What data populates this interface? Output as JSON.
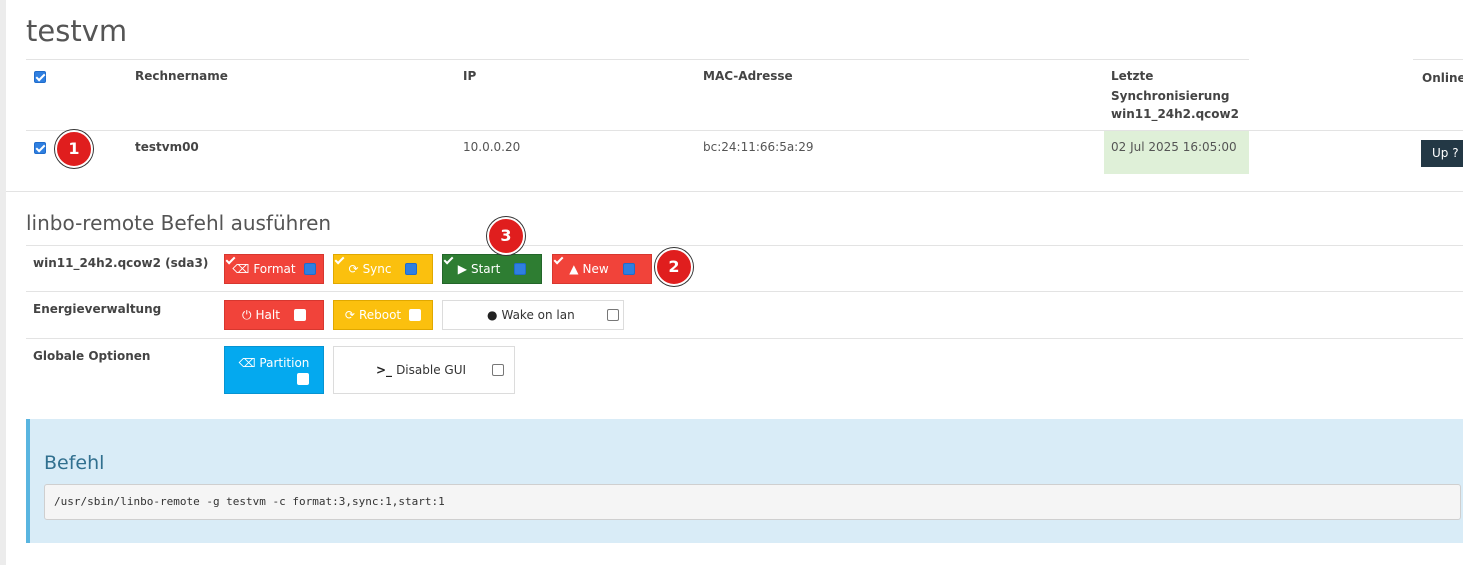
{
  "page": {
    "title": "testvm"
  },
  "table": {
    "headers": {
      "hostname": "Rechnername",
      "ip": "IP",
      "mac": "MAC-Adresse",
      "sync_line1": "Letzte",
      "sync_line2": "Synchronisierung",
      "sync_line3": "win11_24h2.qcow2",
      "online": "Online T"
    },
    "rows": [
      {
        "hostname": "testvm00",
        "ip": "10.0.0.20",
        "mac": "bc:24:11:66:5a:29",
        "last_sync": "02 Jul 2025 16:05:00",
        "online_button": "Up ?"
      }
    ]
  },
  "command_section": {
    "title": "linbo-remote Befehl ausführen",
    "rows": {
      "os_label": "win11_24h2.qcow2 (sda3)",
      "power_label": "Energieverwaltung",
      "global_label": "Globale Optionen"
    },
    "buttons": {
      "format": "Format",
      "sync": "Sync",
      "start": "Start",
      "new": "New",
      "halt": "Halt",
      "reboot": "Reboot",
      "wol": "Wake on lan",
      "partition": "Partition",
      "disable_gui": "Disable GUI"
    }
  },
  "annotations": {
    "badge1": "1",
    "badge2": "2",
    "badge3": "3"
  },
  "command_box": {
    "title": "Befehl",
    "command": "/usr/sbin/linbo-remote -g testvm -c format:3,sync:1,start:1"
  },
  "colors": {
    "red": "#f1433a",
    "yellow": "#fbc00e",
    "green": "#2e7d32",
    "blue": "#04a9ef",
    "dark": "#233845",
    "success_bg": "#dff0d8",
    "info_bg": "#d9ecf7"
  }
}
